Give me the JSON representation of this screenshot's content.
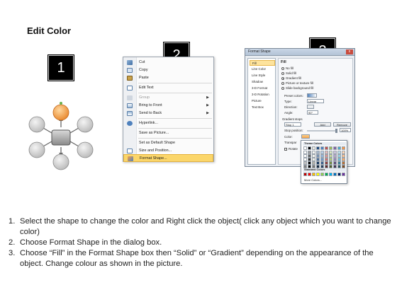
{
  "title": "Edit Color",
  "steps": [
    "1",
    "2",
    "3"
  ],
  "context_menu": {
    "items": [
      {
        "label": "Cut",
        "icon": "scissors-icon",
        "has_submenu": false,
        "disabled": false,
        "highlight": false
      },
      {
        "label": "Copy",
        "icon": "copy-icon",
        "has_submenu": false,
        "disabled": false,
        "highlight": false
      },
      {
        "label": "Paste",
        "icon": "paste-icon",
        "has_submenu": false,
        "disabled": false,
        "highlight": false
      },
      {
        "label": "Edit Text",
        "icon": "edit-text-icon",
        "has_submenu": false,
        "disabled": false,
        "highlight": false
      },
      {
        "label": "Group",
        "icon": "group-icon",
        "has_submenu": true,
        "disabled": true,
        "highlight": false
      },
      {
        "label": "Bring to Front",
        "icon": "bring-front-icon",
        "has_submenu": true,
        "disabled": false,
        "highlight": false
      },
      {
        "label": "Send to Back",
        "icon": "send-back-icon",
        "has_submenu": true,
        "disabled": false,
        "highlight": false
      },
      {
        "label": "Hyperlink...",
        "icon": "hyperlink-icon",
        "has_submenu": false,
        "disabled": false,
        "highlight": false
      },
      {
        "label": "Save as Picture...",
        "icon": "",
        "has_submenu": false,
        "disabled": false,
        "highlight": false
      },
      {
        "label": "Set as Default Shape",
        "icon": "",
        "has_submenu": false,
        "disabled": false,
        "highlight": false
      },
      {
        "label": "Size and Position...",
        "icon": "size-position-icon",
        "has_submenu": false,
        "disabled": false,
        "highlight": false
      },
      {
        "label": "Format Shape...",
        "icon": "format-shape-icon",
        "has_submenu": false,
        "disabled": false,
        "highlight": true
      }
    ]
  },
  "format_dialog": {
    "title": "Format Shape",
    "close": "x",
    "nav": [
      "Fill",
      "Line Color",
      "Line Style",
      "Shadow",
      "3-D Format",
      "3-D Rotation",
      "Picture",
      "Text Box"
    ],
    "heading": "Fill",
    "options": [
      "No fill",
      "Solid fill",
      "Gradient fill",
      "Picture or texture fill",
      "Slide background fill"
    ],
    "selected_option": "Gradient fill",
    "preset_colors": "Preset colors:",
    "type_label": "Type:",
    "type_value": "Linear",
    "direction_label": "Direction:",
    "angle_label": "Angle:",
    "angle_value": "90°",
    "gradient_stops": "Gradient stops",
    "stop_value": "Stop 1",
    "add_button": "Add",
    "remove_button": "Remove",
    "stop_position": "Stop position:",
    "stop_position_value": "100%",
    "color_label": "Color:",
    "transparency_label": "Transpar",
    "rotate_label": "Rotate"
  },
  "color_popup": {
    "theme_colors": "Theme Colors",
    "standard_colors": "Standard Colors",
    "more_colors": "More Colors..."
  },
  "colors": {
    "theme_top": [
      "#ffffff",
      "#000000",
      "#eeece1",
      "#1f497d",
      "#4f81bd",
      "#c0504d",
      "#9bbb59",
      "#8064a2",
      "#4bacc6",
      "#f79646"
    ],
    "standard": [
      "#c00000",
      "#ff0000",
      "#ffc000",
      "#ffff00",
      "#92d050",
      "#00b050",
      "#00b0f0",
      "#0070c0",
      "#002060",
      "#7030a0"
    ],
    "highlight": "#fbd66a",
    "orange_node": "#f5a24a"
  },
  "instructions": [
    "Select the shape to change the color and Right click the object( click any object which you want to change color)",
    "Choose Format Shape in the dialog box.",
    "Choose “Fill” in the Format Shape box then “Solid” or “Gradient” depending on the appearance of the object. Change colour as shown in the picture."
  ]
}
